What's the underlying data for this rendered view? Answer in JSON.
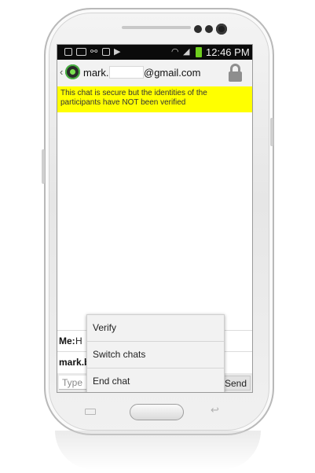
{
  "device": {
    "menu_key_icon": "menu-key-icon",
    "back_key_icon": "back-arrow-icon",
    "nav_back_glyph": "↩"
  },
  "status_bar": {
    "time": "12:46 PM",
    "icons": [
      "image-icon",
      "voicemail-icon",
      "usb-icon",
      "lock-icon",
      "media-icon",
      "wifi-icon",
      "signal-icon",
      "battery-icon"
    ],
    "glyphs": {
      "usb": "⚯",
      "media": "▶",
      "wifi": "◠",
      "signal": "◢"
    },
    "battery_color": "#6fcf1e"
  },
  "header": {
    "back_glyph": "‹",
    "contact_prefix": "mark.",
    "contact_suffix": "@gmail.com",
    "lock_icon": "lock-icon"
  },
  "security_banner": {
    "text": "This chat is secure but the identities of the participants have NOT been verified",
    "color": "#ffff00"
  },
  "messages": [
    {
      "sender": "Me:",
      "text": "H"
    },
    {
      "sender": "mark.b",
      "text": ""
    }
  ],
  "composer": {
    "placeholder": "Type",
    "send_label": "Send"
  },
  "context_menu": {
    "items": [
      "Verify",
      "Switch chats",
      "End chat"
    ]
  }
}
